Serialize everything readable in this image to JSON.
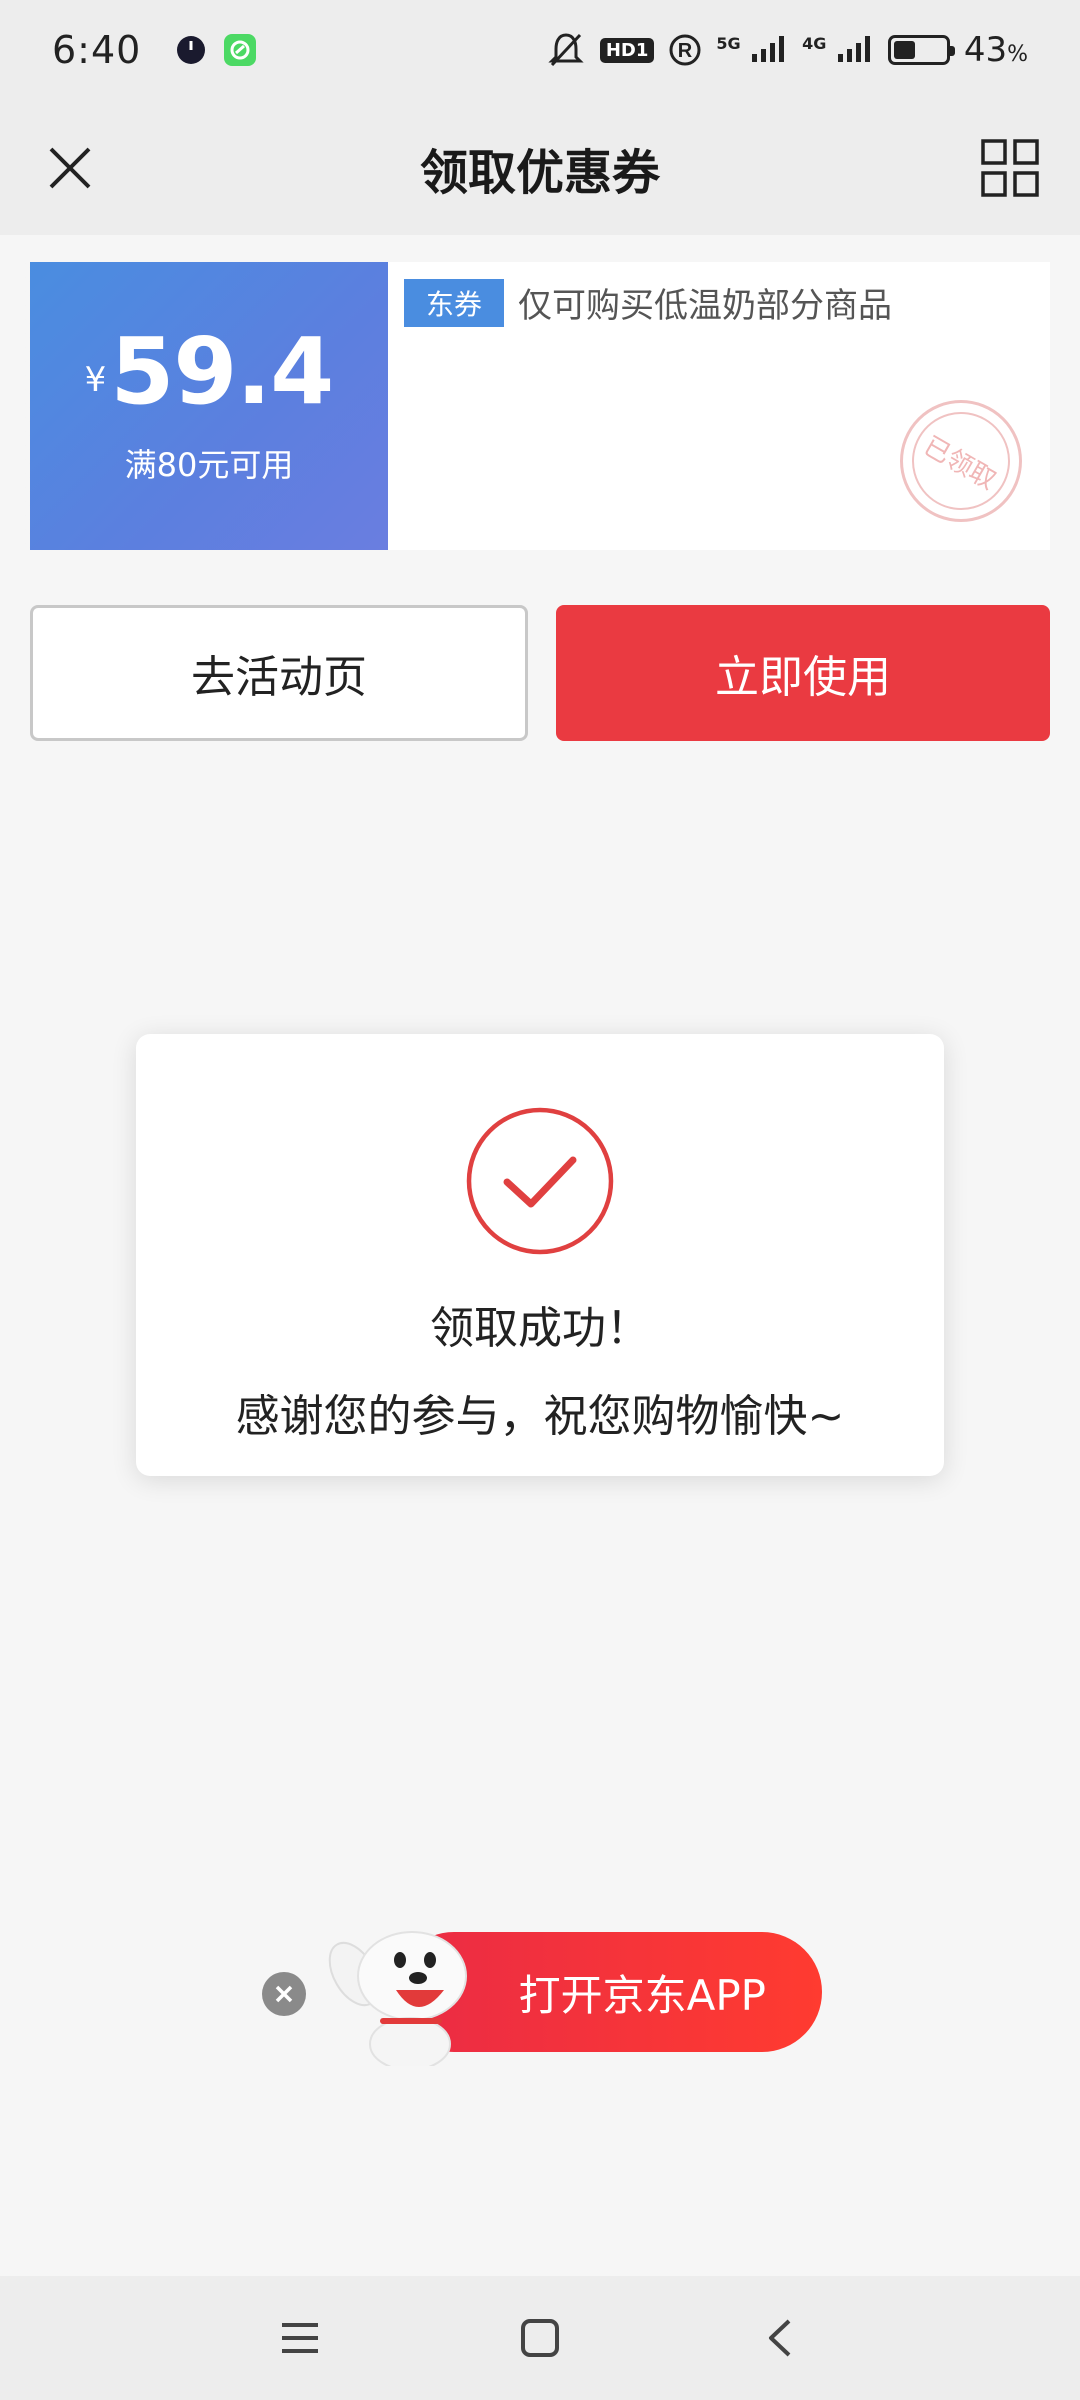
{
  "status_bar": {
    "time": "6:40",
    "hd_badge": "HD1",
    "signal_5g": "5G",
    "signal_4g": "4G",
    "battery_percent": "43",
    "battery_unit": "%",
    "battery_level": 0.43
  },
  "nav": {
    "title": "领取优惠券",
    "close_icon": "close-icon",
    "grid_icon": "grid-icon"
  },
  "coupon": {
    "currency": "¥",
    "amount": "59.4",
    "condition": "满80元可用",
    "tag": "东券",
    "description": "仅可购买低温奶部分商品",
    "stamp_text": "已领取",
    "colors": {
      "left_bg": "#4a8de0",
      "tag_bg": "#4a8de0"
    }
  },
  "actions": {
    "activity_label": "去活动页",
    "use_label": "立即使用",
    "use_color": "#ea3a41"
  },
  "dialog": {
    "title": "领取成功！",
    "message": "感谢您的参与，祝您购物愉快~",
    "icon": "check-circle-icon",
    "accent": "#e04040"
  },
  "banner": {
    "label": "打开京东APP",
    "close_icon": "close-icon",
    "mascot": "joy-dog-mascot"
  },
  "system_nav": {
    "menu_icon": "menu-icon",
    "home_icon": "home-icon",
    "back_icon": "back-icon"
  }
}
